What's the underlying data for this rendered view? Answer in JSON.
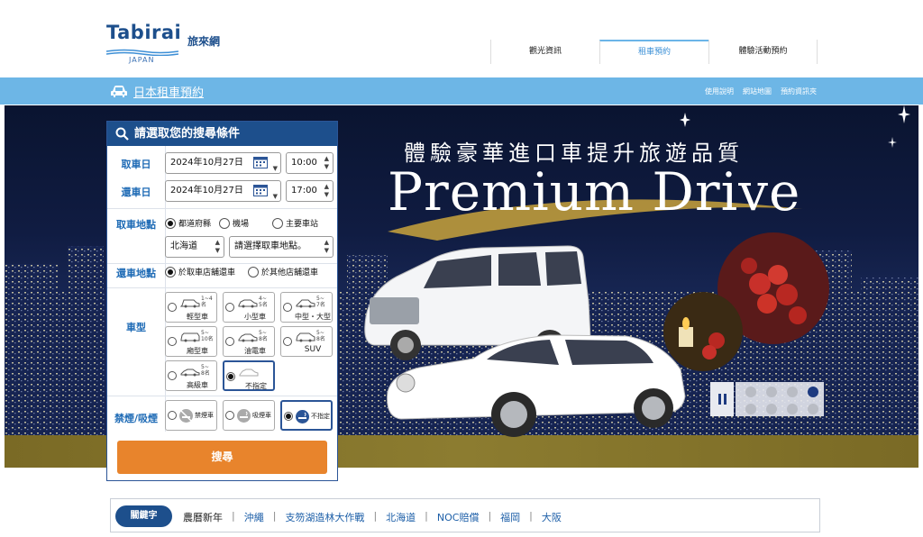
{
  "header": {
    "logo_word": "Tabirai",
    "logo_sub": "JAPAN",
    "logo_cn": "旅來網",
    "nav": [
      {
        "label": "觀光資訊",
        "active": false
      },
      {
        "label": "租車預約",
        "active": true
      },
      {
        "label": "體驗活動預約",
        "active": false
      }
    ]
  },
  "bluebar": {
    "title": "日本租車預約",
    "links": [
      "使用說明",
      "網站地圖",
      "預約資訊夾"
    ]
  },
  "banner": {
    "subtitle": "體驗豪華進口車提升旅遊品質",
    "title": "Premium Drive",
    "slides": 8,
    "active_slide": 4
  },
  "search": {
    "heading": "請選取您的搜尋條件",
    "pickup_date_label": "取車日",
    "pickup_date": "2024年10月27日",
    "pickup_time": "10:00",
    "return_date_label": "還車日",
    "return_date": "2024年10月27日",
    "return_time": "17:00",
    "pickup_place_label": "取車地點",
    "pickup_place_options": [
      "都道府縣",
      "機場",
      "主要車站"
    ],
    "prefecture": "北海道",
    "station_placeholder": "請選擇取車地點。",
    "return_place_label": "還車地點",
    "return_place_options": [
      "於取車店舖還車",
      "於其他店舖還車"
    ],
    "car_type_label": "車型",
    "car_types": [
      {
        "name": "輕型車",
        "cap1": "1~4名",
        "cap2": ""
      },
      {
        "name": "小型車",
        "cap1": "4~",
        "cap2": "5名"
      },
      {
        "name": "中型・大型",
        "cap1": "5~",
        "cap2": "7名"
      },
      {
        "name": "廂型車",
        "cap1": "5~",
        "cap2": "10名"
      },
      {
        "name": "油電車",
        "cap1": "5~",
        "cap2": "8名"
      },
      {
        "name": "SUV",
        "cap1": "5~",
        "cap2": "8名"
      },
      {
        "name": "高級車",
        "cap1": "5~",
        "cap2": "8名"
      },
      {
        "name": "不指定",
        "cap1": "",
        "cap2": ""
      }
    ],
    "smoke_label": "禁煙/吸煙",
    "smoke_options": [
      "禁煙車",
      "吸煙車",
      "不指定"
    ],
    "button": "搜尋"
  },
  "keywords": {
    "badge": "關鍵字",
    "items": [
      "農曆新年",
      "沖繩",
      "支笏湖造林大作戰",
      "北海道",
      "NOC賠償",
      "福岡",
      "大阪"
    ]
  },
  "colors": {
    "brand": "#1d4f8c",
    "bar": "#6db6e6",
    "button": "#e8842c"
  }
}
